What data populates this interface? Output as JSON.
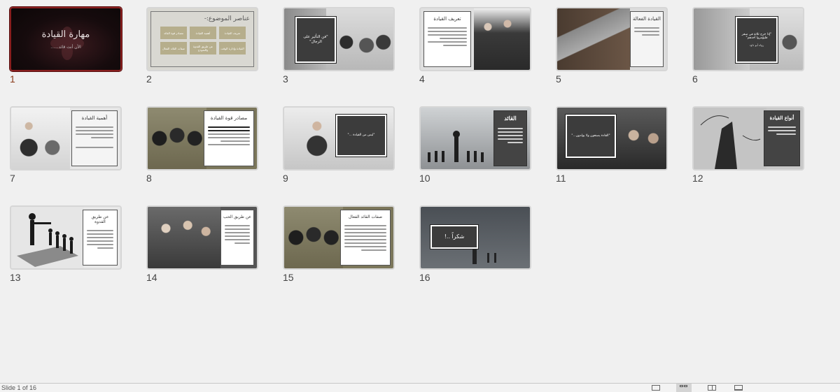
{
  "slides": [
    {
      "number": "1",
      "selected": true,
      "title": "مهارة القيادة",
      "subtitle": "الأن أنت قائد......"
    },
    {
      "number": "2",
      "title": "عناصر الموضوع:-",
      "boxes": [
        "تعريف القيادة",
        "أهمية القيادة",
        "مصادر قوة القائد",
        "القيادة وإدارة الوقت",
        "عن طريق القدوة والنموذج",
        "صفات القائد الفعال"
      ]
    },
    {
      "number": "3",
      "quote": "\"فن التأثير على الرجال\""
    },
    {
      "number": "4",
      "title": "تعريف القيادة"
    },
    {
      "number": "5",
      "title": "القيادة الفعالة"
    },
    {
      "number": "6",
      "quote": "\"إذا خرج ثلاثة في سفر فليؤمروا أحدهم\"",
      "quote_sub": "رواه أبو داود"
    },
    {
      "number": "7",
      "title": "أهمية القيادة"
    },
    {
      "number": "8",
      "title": "مصادر قوة القيادة"
    },
    {
      "number": "9",
      "quote": "\"ليس من القيادة ...\""
    },
    {
      "number": "10",
      "title": "القائد"
    },
    {
      "number": "11",
      "quote": "\"القادة يصنعون ولا يولدون...\""
    },
    {
      "number": "12",
      "title": "أنواع القيادة"
    },
    {
      "number": "13",
      "title": "عن طريق القدوة"
    },
    {
      "number": "14",
      "title": "عن طريق الحب"
    },
    {
      "number": "15",
      "title": "صفات القائد الفعال"
    },
    {
      "number": "16",
      "quote": "شكراً ..!"
    }
  ],
  "statusbar": {
    "slide_counter": "Slide 1 of 16",
    "views": [
      {
        "icon": "normal-view-icon"
      },
      {
        "icon": "slide-sorter-icon",
        "active": true
      },
      {
        "icon": "reading-view-icon"
      },
      {
        "icon": "slideshow-icon"
      }
    ]
  }
}
